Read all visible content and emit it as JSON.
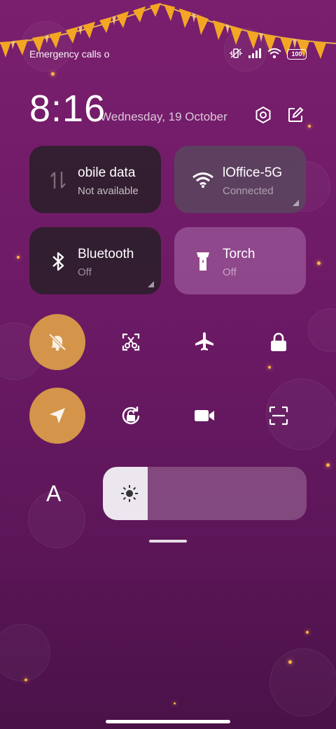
{
  "status_bar": {
    "left_text": "Emergency calls o",
    "battery": "100",
    "icons": [
      "vibrate-icon",
      "signal-icon",
      "wifi-icon",
      "battery-icon"
    ]
  },
  "header": {
    "time": "8:16",
    "date": "Wednesday, 19 October",
    "actions": [
      "settings-icon",
      "edit-icon"
    ]
  },
  "tiles": [
    {
      "title": "obile data",
      "subtitle": "Not available",
      "icon": "mobile-data-icon",
      "state": "off"
    },
    {
      "title": "lOffice-5G",
      "subtitle": "Connected",
      "icon": "wifi-icon",
      "state": "on"
    },
    {
      "title": "Bluetooth",
      "subtitle": "Off",
      "icon": "bluetooth-icon",
      "state": "off"
    },
    {
      "title": "Torch",
      "subtitle": "Off",
      "icon": "torch-icon",
      "state": "off"
    }
  ],
  "toggles_row1": [
    {
      "icon": "mute-icon",
      "active": true
    },
    {
      "icon": "screenshot-icon",
      "active": false
    },
    {
      "icon": "airplane-icon",
      "active": false
    },
    {
      "icon": "lock-icon",
      "active": false
    }
  ],
  "toggles_row2": [
    {
      "icon": "location-icon",
      "active": true
    },
    {
      "icon": "rotation-lock-icon",
      "active": false
    },
    {
      "icon": "screen-recorder-icon",
      "active": false
    },
    {
      "icon": "scanner-icon",
      "active": false
    }
  ],
  "brightness": {
    "auto_label": "A",
    "level": 0.22,
    "icon": "brightness-icon"
  },
  "colors": {
    "accent": "#d4954a",
    "background_top": "#7a1f6e",
    "background_bottom": "#4a1148"
  }
}
